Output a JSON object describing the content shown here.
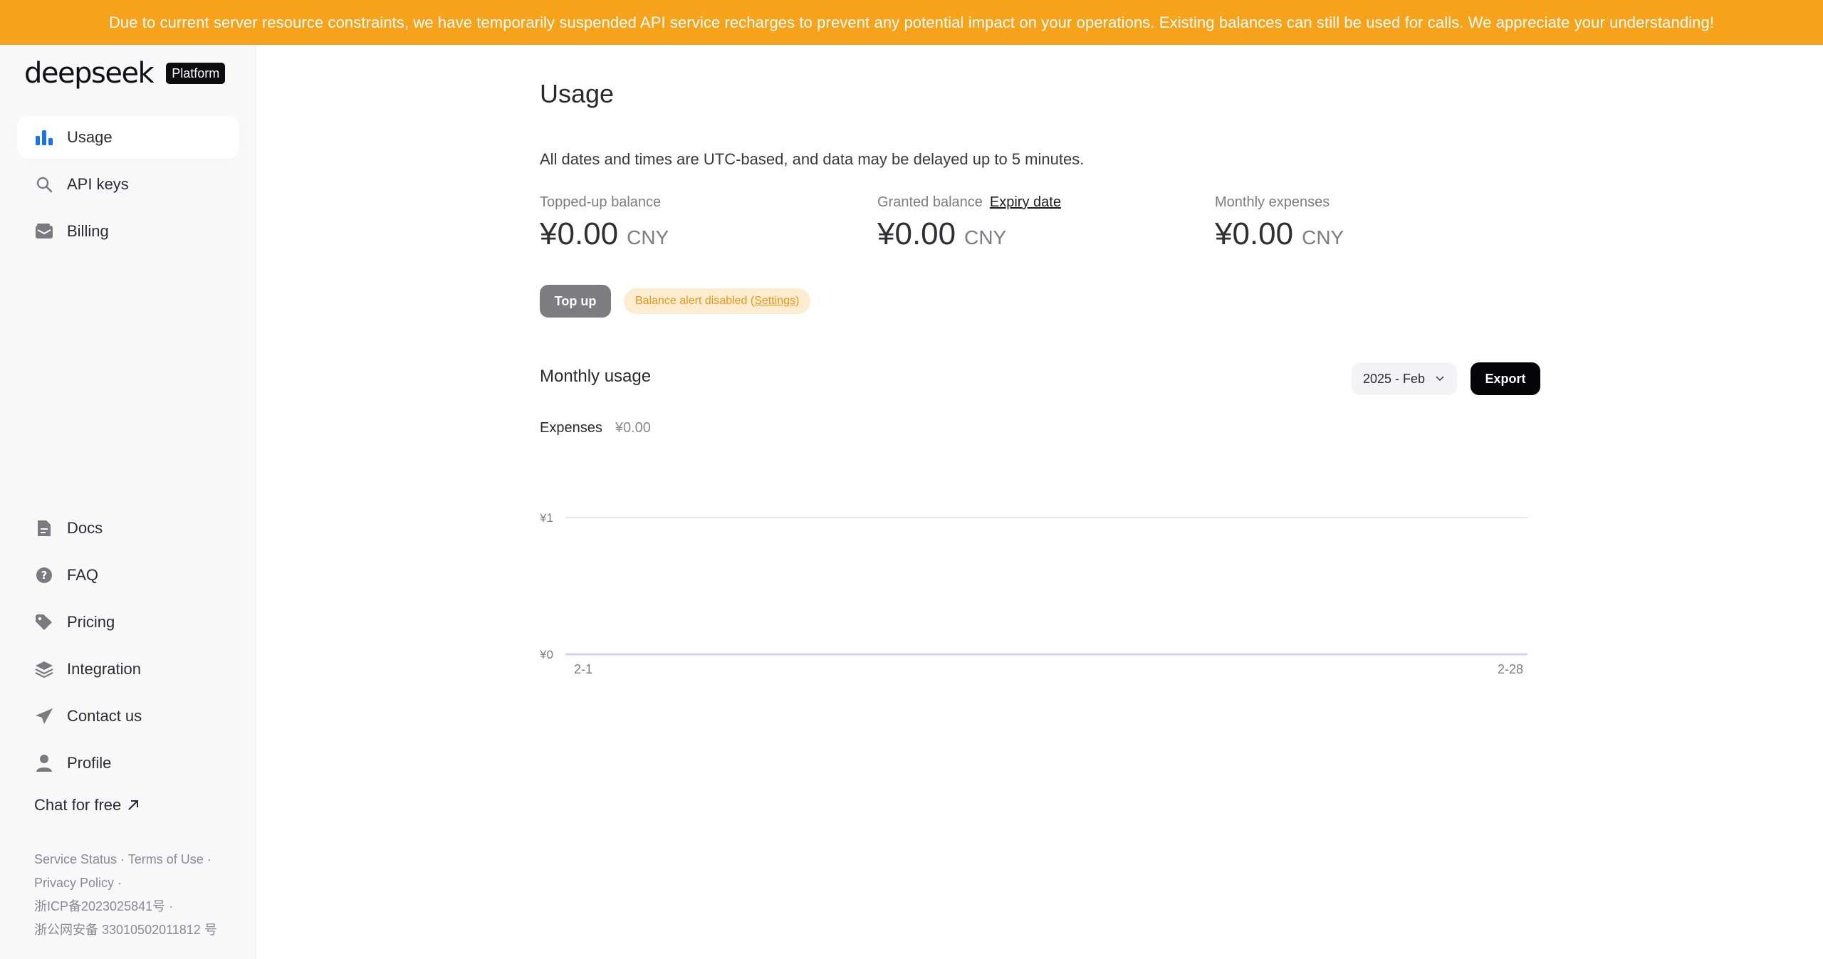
{
  "banner": {
    "text": "Due to current server resource constraints, we have temporarily suspended API service recharges to prevent any potential impact on your operations. Existing balances can still be used for calls. We appreciate your understanding!"
  },
  "sidebar": {
    "logo": "deepseek",
    "badge": "Platform",
    "top_items": [
      {
        "label": "Usage",
        "icon": "bar-chart-icon",
        "active": true
      },
      {
        "label": "API keys",
        "icon": "search-icon"
      },
      {
        "label": "Billing",
        "icon": "wallet-icon"
      }
    ],
    "bottom_items": [
      {
        "label": "Docs",
        "icon": "document-icon"
      },
      {
        "label": "FAQ",
        "icon": "question-icon"
      },
      {
        "label": "Pricing",
        "icon": "tag-icon"
      },
      {
        "label": "Integration",
        "icon": "layers-icon"
      },
      {
        "label": "Contact us",
        "icon": "send-icon"
      },
      {
        "label": "Profile",
        "icon": "user-icon"
      }
    ],
    "chat_free": "Chat for free",
    "footer": {
      "service_status": "Service Status",
      "terms": "Terms of Use",
      "privacy": "Privacy Policy",
      "icp": "浙ICP备2023025841号",
      "police": "浙公网安备 33010502011812 号"
    }
  },
  "main": {
    "title": "Usage",
    "notice": "All dates and times are UTC-based, and data may be delayed up to 5 minutes.",
    "balances": [
      {
        "label": "Topped-up balance",
        "amount": "¥0.00",
        "currency": "CNY"
      },
      {
        "label": "Granted balance",
        "link": "Expiry date",
        "amount": "¥0.00",
        "currency": "CNY"
      },
      {
        "label": "Monthly expenses",
        "amount": "¥0.00",
        "currency": "CNY"
      }
    ],
    "topup_label": "Top up",
    "alert_text": "Balance alert disabled (",
    "alert_settings": "Settings",
    "alert_close": ")",
    "monthly_title": "Monthly usage",
    "month_selected": "2025 - Feb",
    "export_label": "Export",
    "expenses_label": "Expenses",
    "expenses_value": "¥0.00"
  },
  "colors": {
    "banner": "#f7a21b",
    "accent": "#1a73e8",
    "alert_bg": "#fdeccf",
    "alert_text": "#e6951a"
  },
  "chart_data": {
    "type": "line",
    "x_tick_labels": [
      "2-1",
      "2-28"
    ],
    "y_tick_labels": [
      "¥1",
      "¥0"
    ],
    "ylim": [
      0,
      1
    ],
    "x": [
      "2-1",
      "2-28"
    ],
    "series": [
      {
        "values": [
          0,
          0
        ]
      }
    ],
    "grid": true
  }
}
